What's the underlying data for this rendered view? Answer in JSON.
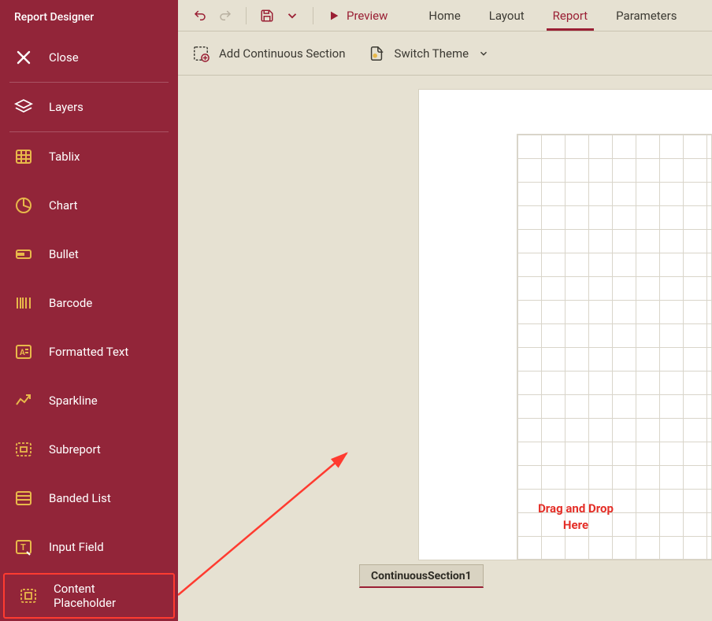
{
  "sidebar": {
    "title": "Report Designer",
    "items": [
      {
        "label": "Close"
      },
      {
        "label": "Layers"
      },
      {
        "label": "Tablix"
      },
      {
        "label": "Chart"
      },
      {
        "label": "Bullet"
      },
      {
        "label": "Barcode"
      },
      {
        "label": "Formatted Text"
      },
      {
        "label": "Sparkline"
      },
      {
        "label": "Subreport"
      },
      {
        "label": "Banded List"
      },
      {
        "label": "Input Field"
      },
      {
        "label": "Content Placeholder"
      }
    ]
  },
  "topbar": {
    "preview_label": "Preview",
    "tabs": [
      {
        "label": "Home"
      },
      {
        "label": "Layout"
      },
      {
        "label": "Report"
      },
      {
        "label": "Parameters"
      }
    ]
  },
  "ribbon": {
    "add_section_label": "Add Continuous Section",
    "switch_theme_label": "Switch Theme"
  },
  "canvas": {
    "drop_label_l1": "Drag and Drop",
    "drop_label_l2": "Here",
    "section_tab_label": "ContinuousSection1"
  },
  "colors": {
    "accent": "#9a1f34",
    "annotation": "#ff3b30"
  }
}
